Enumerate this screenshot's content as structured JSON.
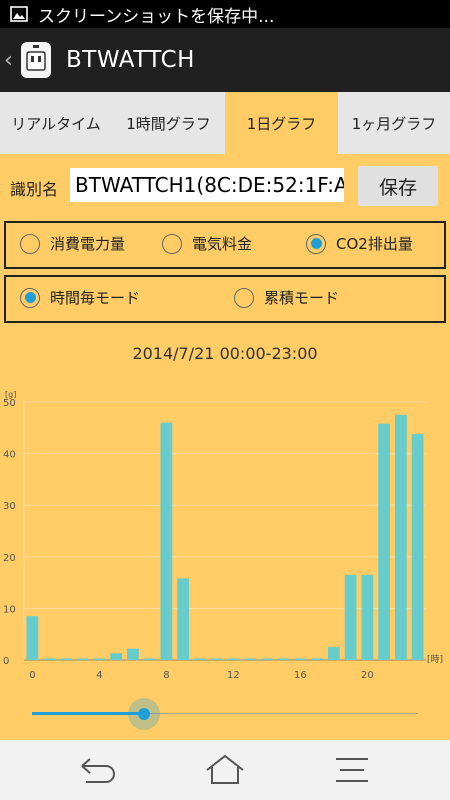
{
  "status_bar": {
    "notification_text": "スクリーンショットを保存中..."
  },
  "action_bar": {
    "title": "BTWATTCH"
  },
  "tabs": [
    {
      "label": "リアルタイム",
      "active": false
    },
    {
      "label": "1時間グラフ",
      "active": false
    },
    {
      "label": "1日グラフ",
      "active": true
    },
    {
      "label": "1ヶ月グラフ",
      "active": false
    }
  ],
  "identifier": {
    "label": "識別名",
    "value": "BTWATTCH1(8C:DE:52:1F:A",
    "save_label": "保存"
  },
  "metric_options": [
    {
      "label": "消費電力量",
      "checked": false
    },
    {
      "label": "電気料金",
      "checked": false
    },
    {
      "label": "CO2排出量",
      "checked": true
    }
  ],
  "mode_options": [
    {
      "label": "時間毎モード",
      "checked": true
    },
    {
      "label": "累積モード",
      "checked": false
    }
  ],
  "date_range": "2014/7/21 00:00-23:00",
  "chart_data": {
    "type": "bar",
    "ylabel": "[g]",
    "xlabel": "[時]",
    "x": [
      0,
      1,
      2,
      3,
      4,
      5,
      6,
      7,
      8,
      9,
      10,
      11,
      12,
      13,
      14,
      15,
      16,
      17,
      18,
      19,
      20,
      21,
      22,
      23
    ],
    "values": [
      8.5,
      0.3,
      0.3,
      0.3,
      0.3,
      1.3,
      2.2,
      0.3,
      46,
      15.8,
      0.3,
      0.3,
      0.3,
      0.3,
      0.3,
      0.3,
      0.3,
      0.3,
      2.5,
      16.5,
      16.5,
      45.8,
      47.5,
      43.8
    ],
    "ylim": [
      0,
      50
    ],
    "yticks": [
      0,
      10,
      20,
      30,
      40,
      50
    ],
    "xticks": [
      0,
      4,
      8,
      12,
      16,
      20
    ],
    "bar_color": "#66cccc",
    "grid": true
  },
  "slider": {
    "value": 0.29
  },
  "colors": {
    "accent": "#1e9fd8",
    "background": "#ffcc66"
  },
  "nav_bar": {
    "icons": [
      "back-icon",
      "home-icon",
      "menu-icon"
    ]
  }
}
